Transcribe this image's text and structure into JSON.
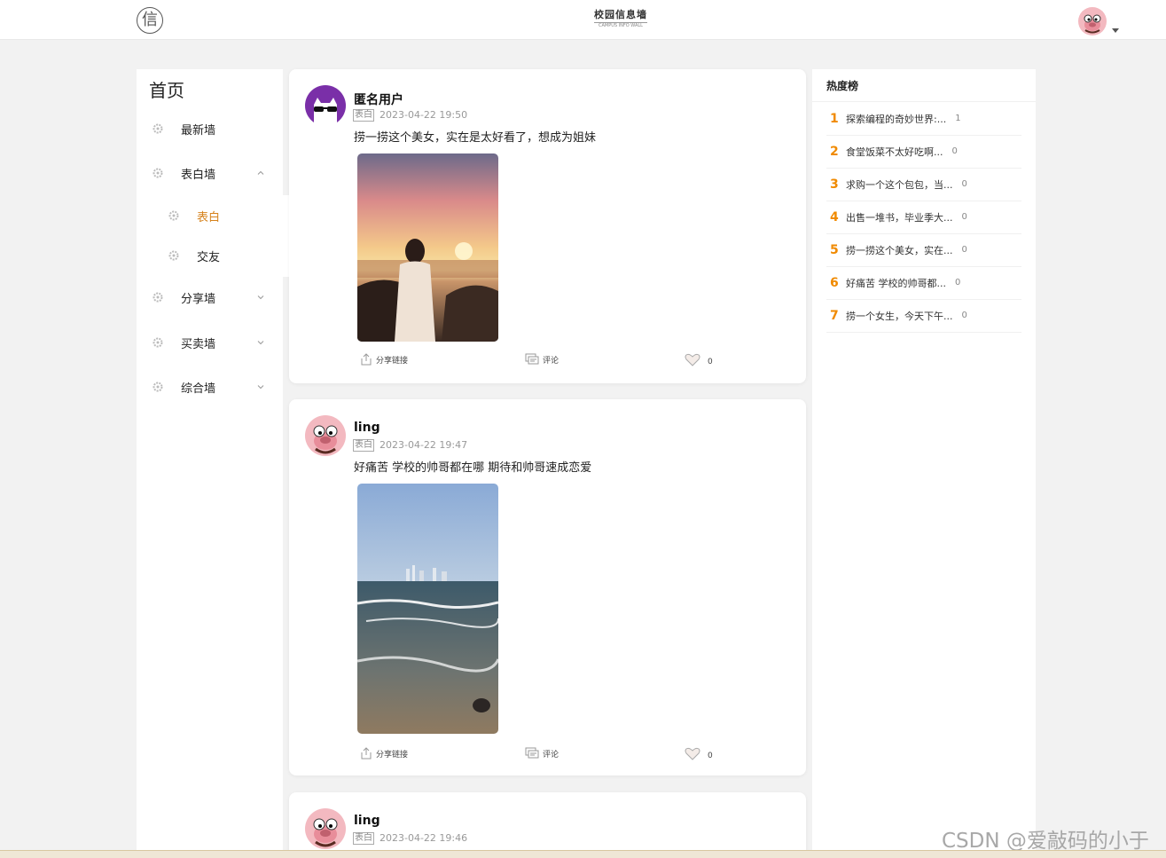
{
  "header": {
    "logo_char": "信",
    "brand_title": "校园信息墙",
    "brand_sub": "CAMPUS INFO WALL"
  },
  "sidebar": {
    "home_title": "首页",
    "items": [
      {
        "label": "最新墙",
        "icon": "gear-icon",
        "expanded": false
      },
      {
        "label": "表白墙",
        "icon": "gear-icon",
        "expanded": true
      },
      {
        "label": "表白",
        "icon": "gear-icon",
        "sub": true,
        "active": true
      },
      {
        "label": "交友",
        "icon": "gear-icon",
        "sub": true
      },
      {
        "label": "分享墙",
        "icon": "gear-icon",
        "expanded": false
      },
      {
        "label": "买卖墙",
        "icon": "gear-icon",
        "expanded": false
      },
      {
        "label": "综合墙",
        "icon": "gear-icon",
        "expanded": false
      }
    ]
  },
  "posts": [
    {
      "username": "匿名用户",
      "tag": "表白",
      "time": "2023-04-22 19:50",
      "content": "捞一捞这个美女，实在是太好看了，想成为姐妹",
      "share": "分享链接",
      "comment": "评论",
      "likes": "0"
    },
    {
      "username": "ling",
      "tag": "表白",
      "time": "2023-04-22 19:47",
      "content": "好痛苦 学校的帅哥都在哪 期待和帅哥速成恋爱",
      "share": "分享链接",
      "comment": "评论",
      "likes": "0"
    },
    {
      "username": "ling",
      "tag": "表白",
      "time": "2023-04-22 19:46"
    }
  ],
  "hot": {
    "title": "热度榜",
    "items": [
      {
        "rank": "1",
        "title": "探索编程的奇妙世界:...",
        "count": "1"
      },
      {
        "rank": "2",
        "title": "食堂饭菜不太好吃啊...",
        "count": "0"
      },
      {
        "rank": "3",
        "title": "求购一个这个包包，当...",
        "count": "0"
      },
      {
        "rank": "4",
        "title": "出售一堆书，毕业季大...",
        "count": "0"
      },
      {
        "rank": "5",
        "title": "捞一捞这个美女，实在...",
        "count": "0"
      },
      {
        "rank": "6",
        "title": "好痛苦 学校的帅哥都...",
        "count": "0"
      },
      {
        "rank": "7",
        "title": "捞一个女生，今天下午...",
        "count": "0"
      }
    ]
  },
  "watermark": "CSDN @爱敲码的小于",
  "colors": {
    "accent": "#d6821c",
    "rank": "#f08a00",
    "page_bg": "#f2f2f2"
  }
}
